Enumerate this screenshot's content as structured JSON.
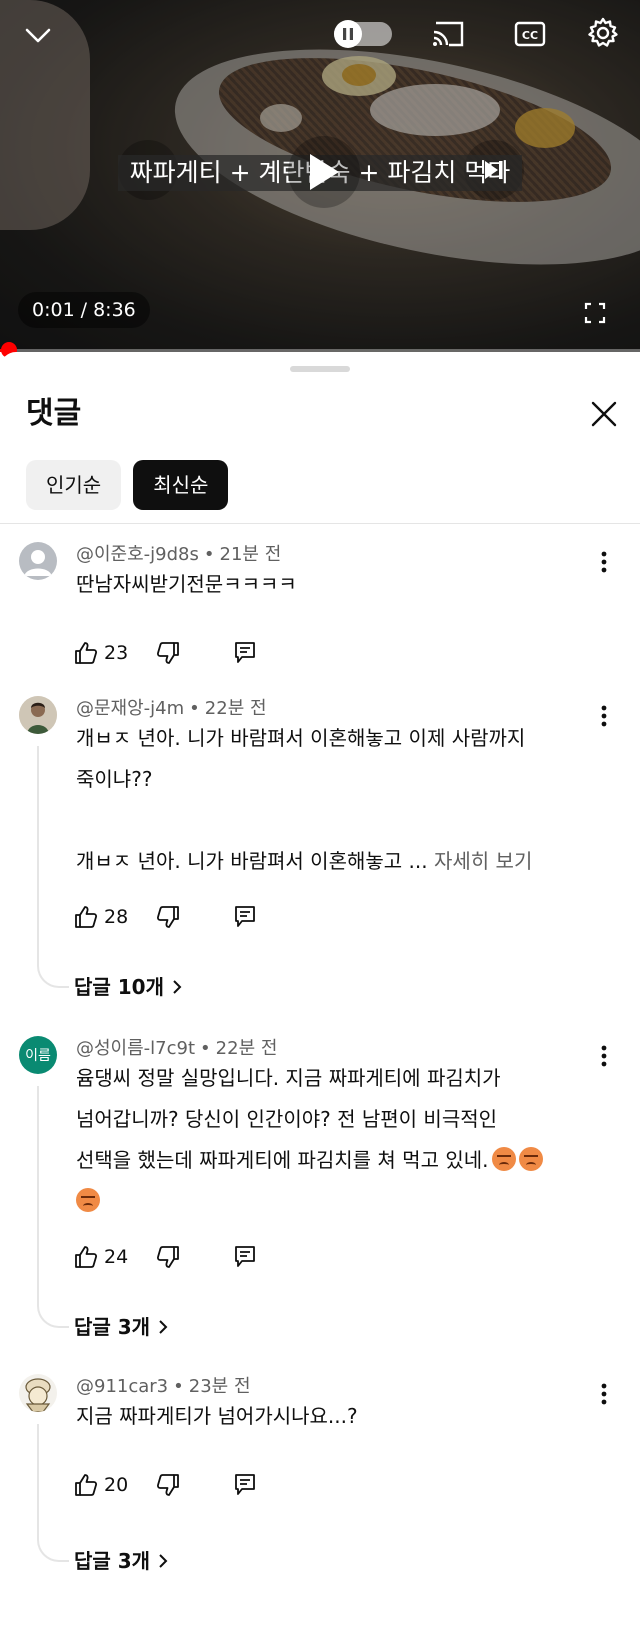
{
  "player": {
    "video_caption": "짜파게티 + 계란반숙 + 파김치 먹다",
    "current_time": "0:01",
    "time_separator": "/",
    "duration": "8:36",
    "progress_fraction": 0.002,
    "autoplay_on": false,
    "accent_color": "#ff0000"
  },
  "comments_panel": {
    "title": "댓글",
    "sort_chips": [
      {
        "label": "인기순",
        "selected": false
      },
      {
        "label": "최신순",
        "selected": true
      }
    ],
    "comments": [
      {
        "author": "@이준호-j9d8s",
        "time": "21분 전",
        "avatar": "default-avatar",
        "lines": [
          "딴남자씨받기전문ㅋㅋㅋㅋ"
        ],
        "likes": "23"
      },
      {
        "author": "@문재앙-j4m",
        "time": "22분 전",
        "avatar": "photo-avatar",
        "lines": [
          "개ㅂㅈ 년아. 니가 바람펴서 이혼해놓고 이제 사람까지",
          "죽이냐??"
        ],
        "lines_b": [
          "개ㅂㅈ 년아. 니가 바람펴서 이혼해놓고 ..."
        ],
        "see_more": "자세히 보기",
        "likes": "28",
        "replies": "답글 10개"
      },
      {
        "author": "@성이름-l7c9t",
        "time": "22분 전",
        "avatar": "letter-avatar",
        "avatar_text": "이름",
        "lines": [
          "윰댕씨 정말 실망입니다. 지금 짜파게티에 파김치가",
          "넘어갑니까? 당신이 인간이야? 전 남편이 비극적인",
          "선택을 했는데 짜파게티에 파김치를 쳐 먹고 있네."
        ],
        "emoji": "angry-face",
        "likes": "24",
        "replies": "답글 3개"
      },
      {
        "author": "@911car3",
        "time": "23분 전",
        "avatar": "cartoon-avatar",
        "lines": [
          "지금 짜파게티가 넘어가시나요...?"
        ],
        "likes": "20",
        "replies": "답글 3개"
      }
    ]
  }
}
